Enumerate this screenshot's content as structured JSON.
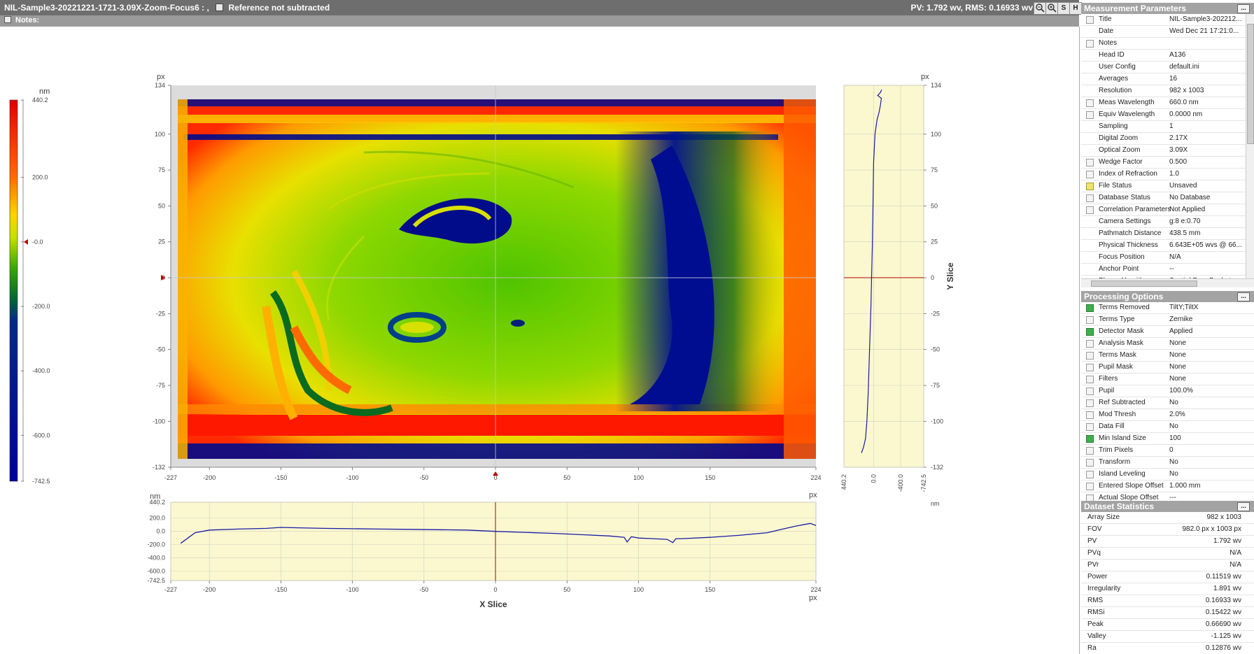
{
  "title_bar": {
    "dataset_name": "NIL-Sample3-20221221-1721-3.09X-Zoom-Focus6 : ,",
    "reference_label": "Reference not subtracted",
    "pv_rms": "PV: 1.792 wv, RMS: 0.16933 wv",
    "buttons": [
      "S",
      "H"
    ]
  },
  "notes_label": "Notes:",
  "colorbar": {
    "unit": "nm",
    "ticks": [
      "440.2",
      "200.0",
      "-0.0",
      "-200.0",
      "-400.0",
      "-600.0",
      "-742.5"
    ],
    "tick_values": [
      440.2,
      200.0,
      0.0,
      -200.0,
      -400.0,
      -600.0,
      -742.5
    ],
    "max": 440.2,
    "min": -742.5,
    "marker_value": 0.0
  },
  "main_plot": {
    "y_unit": "px",
    "x_range": [
      -227,
      224
    ],
    "y_range": [
      -132,
      134
    ],
    "x_ticks": [
      -227,
      -200,
      -150,
      -100,
      -50,
      0,
      50,
      100,
      150,
      224
    ],
    "y_ticks": [
      134,
      100,
      75,
      50,
      25,
      0,
      -25,
      -50,
      -75,
      -100,
      -132
    ],
    "crosshair": {
      "x": 0,
      "y": 0
    }
  },
  "x_slice": {
    "label": "X Slice",
    "y_unit": "nm",
    "x_unit": "px",
    "y_ticks": [
      "440.2",
      "200.0",
      "0.0",
      "-200.0",
      "-400.0",
      "-600.0",
      "-742.5"
    ],
    "x_ticks": [
      -227,
      -200,
      -150,
      -100,
      -50,
      0,
      50,
      100,
      150,
      224
    ]
  },
  "y_slice": {
    "label": "Y Slice",
    "y_unit": "px",
    "x_unit": "nm",
    "x_ticks": [
      "440.2",
      "0.0",
      "-400.0",
      "-742.5"
    ],
    "y_ticks": [
      134,
      100,
      75,
      50,
      25,
      0,
      -25,
      -50,
      -75,
      -100,
      -132
    ]
  },
  "chart_data": [
    {
      "type": "line",
      "x": [
        -220,
        -210,
        -200,
        -180,
        -160,
        -150,
        -140,
        -120,
        -100,
        -80,
        -60,
        -40,
        -20,
        0,
        20,
        40,
        60,
        80,
        90,
        92,
        95,
        100,
        110,
        120,
        124,
        126,
        130,
        150,
        170,
        190,
        200,
        210,
        220,
        224
      ],
      "y": [
        -180,
        -20,
        20,
        35,
        45,
        60,
        55,
        45,
        40,
        35,
        30,
        25,
        20,
        0,
        -15,
        -30,
        -50,
        -70,
        -90,
        -160,
        -80,
        -100,
        -110,
        -120,
        -170,
        -110,
        -110,
        -90,
        -60,
        -20,
        30,
        80,
        120,
        90
      ],
      "xlim": [
        -227,
        224
      ],
      "ylim": [
        -742.5,
        440.2
      ]
    },
    {
      "type": "line",
      "x": [
        180,
        150,
        120,
        100,
        80,
        60,
        40,
        30,
        20,
        10,
        0,
        -20,
        -50,
        -80,
        -100,
        -115,
        -60,
        -100,
        -120
      ],
      "y": [
        -122,
        -118,
        -112,
        -100,
        -80,
        -50,
        -20,
        0,
        20,
        50,
        80,
        100,
        110,
        115,
        120,
        125,
        127,
        129,
        131
      ],
      "xlim": [
        -742.5,
        440.2
      ],
      "ylim": [
        -132,
        134
      ]
    }
  ],
  "measurement_parameters": {
    "title": "Measurement Parameters",
    "rows": [
      {
        "k": "Title",
        "v": "NIL-Sample3-202212...",
        "cb": "gray"
      },
      {
        "k": "Date",
        "v": "Wed Dec 21 17:21:0...",
        "cb": "none"
      },
      {
        "k": "Notes",
        "v": "",
        "cb": "gray"
      },
      {
        "k": "Head ID",
        "v": "A136",
        "cb": "none"
      },
      {
        "k": "User Config",
        "v": "default.ini",
        "cb": "none"
      },
      {
        "k": "Averages",
        "v": "16",
        "cb": "none"
      },
      {
        "k": "Resolution",
        "v": "982 x 1003",
        "cb": "none"
      },
      {
        "k": "Meas Wavelength",
        "v": "660.0 nm",
        "cb": "gray"
      },
      {
        "k": "Equiv Wavelength",
        "v": "0.0000 nm",
        "cb": "gray"
      },
      {
        "k": "Sampling",
        "v": "1",
        "cb": "none"
      },
      {
        "k": "Digital Zoom",
        "v": "2.17X",
        "cb": "none"
      },
      {
        "k": "Optical Zoom",
        "v": "3.09X",
        "cb": "none"
      },
      {
        "k": "Wedge Factor",
        "v": "0.500",
        "cb": "gray"
      },
      {
        "k": "Index of Refraction",
        "v": "1.0",
        "cb": "gray"
      },
      {
        "k": "File Status",
        "v": "Unsaved",
        "cb": "yellow"
      },
      {
        "k": "Database Status",
        "v": "No Database",
        "cb": "gray"
      },
      {
        "k": "Correlation Parameters",
        "v": "Not Applied",
        "cb": "gray"
      },
      {
        "k": "Camera Settings",
        "v": "g:8 e:0.70",
        "cb": "none"
      },
      {
        "k": "Pathmatch Distance",
        "v": "438.5 mm",
        "cb": "none"
      },
      {
        "k": "Physical Thickness",
        "v": "6.643E+05 wvs @ 66...",
        "cb": "none"
      },
      {
        "k": "Focus Position",
        "v": "N/A",
        "cb": "none"
      },
      {
        "k": "Anchor Point",
        "v": "--",
        "cb": "none"
      },
      {
        "k": "Phase Algorithm",
        "v": "Spatial Four-Bucket",
        "cb": "none"
      }
    ]
  },
  "processing_options": {
    "title": "Processing Options",
    "rows": [
      {
        "k": "Terms Removed",
        "v": "TiltY;TiltX",
        "cb": "green"
      },
      {
        "k": "Terms Type",
        "v": "Zernike",
        "cb": "gray"
      },
      {
        "k": "Detector Mask",
        "v": "Applied",
        "cb": "green"
      },
      {
        "k": "Analysis Mask",
        "v": "None",
        "cb": "gray"
      },
      {
        "k": "Terms Mask",
        "v": "None",
        "cb": "gray"
      },
      {
        "k": "Pupil Mask",
        "v": "None",
        "cb": "gray"
      },
      {
        "k": "Filters",
        "v": "None",
        "cb": "gray"
      },
      {
        "k": "Pupil",
        "v": "100.0%",
        "cb": "gray"
      },
      {
        "k": "Ref Subtracted",
        "v": "No",
        "cb": "gray"
      },
      {
        "k": "Mod Thresh",
        "v": "2.0%",
        "cb": "gray"
      },
      {
        "k": "Data Fill",
        "v": "No",
        "cb": "gray"
      },
      {
        "k": "Min Island Size",
        "v": "100",
        "cb": "green"
      },
      {
        "k": "Trim Pixels",
        "v": "0",
        "cb": "gray"
      },
      {
        "k": "Transform",
        "v": "No",
        "cb": "gray"
      },
      {
        "k": "Island Leveling",
        "v": "No",
        "cb": "gray"
      },
      {
        "k": "Entered Slope Offset",
        "v": "1.000 mm",
        "cb": "gray"
      },
      {
        "k": "Actual Slope Offset",
        "v": "---",
        "cb": "gray"
      }
    ]
  },
  "dataset_statistics": {
    "title": "Dataset Statistics",
    "rows": [
      {
        "k": "Array Size",
        "v": "982 x 1003"
      },
      {
        "k": "FOV",
        "v": "982.0 px x 1003 px"
      },
      {
        "k": "PV",
        "v": "1.792 wv"
      },
      {
        "k": "PVq",
        "v": "N/A"
      },
      {
        "k": "PVr",
        "v": "N/A"
      },
      {
        "k": "Power",
        "v": "0.11519 wv"
      },
      {
        "k": "Irregularity",
        "v": "1.891 wv"
      },
      {
        "k": "RMS",
        "v": "0.16933 wv"
      },
      {
        "k": "RMSi",
        "v": "0.15422 wv"
      },
      {
        "k": "Peak",
        "v": "0.66690 wv"
      },
      {
        "k": "Valley",
        "v": "-1.125 wv"
      },
      {
        "k": "Ra",
        "v": "0.12876 wv"
      }
    ]
  },
  "colors": {
    "plot_bg": "#fbf8cf",
    "trace": "#1a1aa8",
    "crosshair": "#b40000",
    "header_gray": "#a3a3a3"
  }
}
